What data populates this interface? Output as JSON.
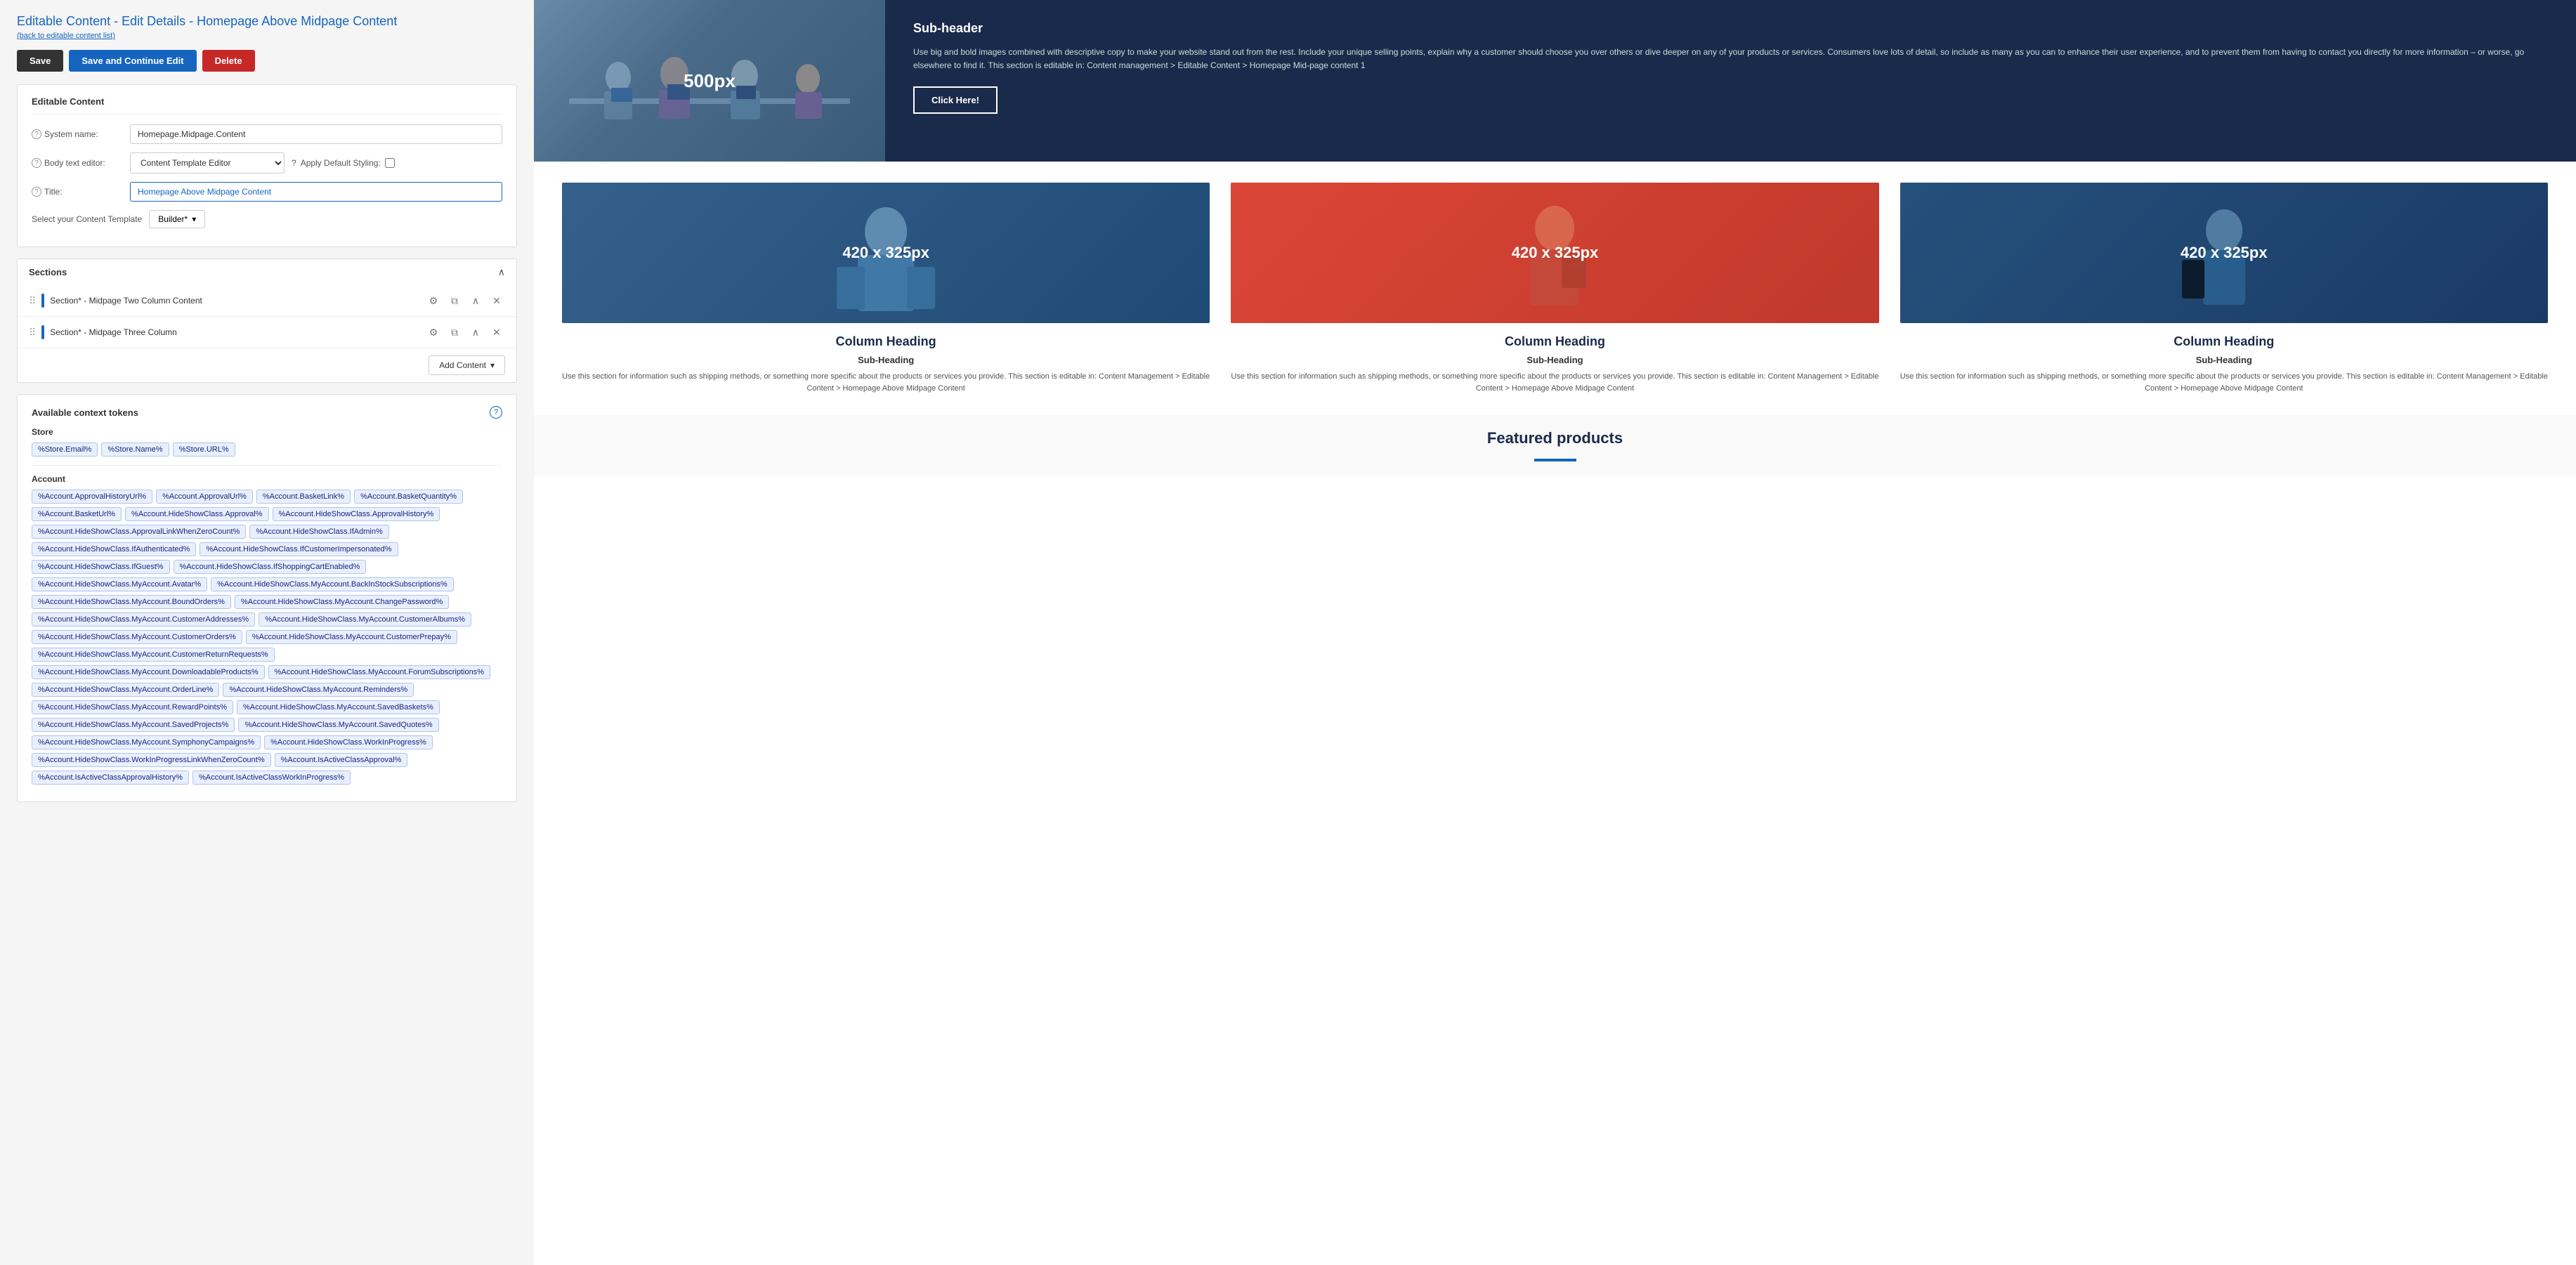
{
  "page": {
    "title_prefix": "Editable Content - Edit Details - ",
    "title_link": "Homepage Above Midpage Content",
    "back_link": "(back to editable content list)"
  },
  "toolbar": {
    "save_label": "Save",
    "save_continue_label": "Save and Continue Edit",
    "delete_label": "Delete"
  },
  "form": {
    "card_title": "Editable Content",
    "system_name_label": "System name:",
    "system_name_value": "Homepage.Midpage.Content",
    "body_editor_label": "Body text editor:",
    "body_editor_value": "Content Template Editor",
    "apply_styling_label": "Apply Default Styling:",
    "title_label": "Title:",
    "title_value": "Homepage Above Midpage Content",
    "template_label": "Select your Content Template",
    "template_value": "Builder*"
  },
  "sections": {
    "title": "Sections",
    "items": [
      {
        "name": "Section* - Midpage Two Column Content"
      },
      {
        "name": "Section* - Midpage Three Column"
      }
    ],
    "add_content_label": "Add Content"
  },
  "tokens": {
    "title": "Available context tokens",
    "store_group": "Store",
    "store_tokens": [
      "%Store.Email%",
      "%Store.Name%",
      "%Store.URL%"
    ],
    "account_group": "Account",
    "account_tokens": [
      "%Account.ApprovalHistoryUrl%",
      "%Account.ApprovalUrl%",
      "%Account.BasketLink%",
      "%Account.BasketQuantity%",
      "%Account.BasketUrl%",
      "%Account.HideShowClass.Approval%",
      "%Account.HideShowClass.ApprovalHistory%",
      "%Account.HideShowClass.ApprovalLinkWhenZeroCount%",
      "%Account.HideShowClass.IfAdmin%",
      "%Account.HideShowClass.IfAuthenticated%",
      "%Account.HideShowClass.IfCustomerImpersonated%",
      "%Account.HideShowClass.IfGuest%",
      "%Account.HideShowClass.IfShoppingCartEnabled%",
      "%Account.HideShowClass.MyAccount.Avatar%",
      "%Account.HideShowClass.MyAccount.BackInStockSubscriptions%",
      "%Account.HideShowClass.MyAccount.BoundOrders%",
      "%Account.HideShowClass.MyAccount.ChangePassword%",
      "%Account.HideShowClass.MyAccount.CustomerAddresses%",
      "%Account.HideShowClass.MyAccount.CustomerAlbums%",
      "%Account.HideShowClass.MyAccount.CustomerOrders%",
      "%Account.HideShowClass.MyAccount.CustomerPrepay%",
      "%Account.HideShowClass.MyAccount.CustomerReturnRequests%",
      "%Account.HideShowClass.MyAccount.DownloadableProducts%",
      "%Account.HideShowClass.MyAccount.ForumSubscriptions%",
      "%Account.HideShowClass.MyAccount.OrderLine%",
      "%Account.HideShowClass.MyAccount.Reminders%",
      "%Account.HideShowClass.MyAccount.RewardPoints%",
      "%Account.HideShowClass.MyAccount.SavedBaskets%",
      "%Account.HideShowClass.MyAccount.SavedProjects%",
      "%Account.HideShowClass.MyAccount.SavedQuotes%",
      "%Account.HideShowClass.MyAccount.SymphonyCampaigns%",
      "%Account.HideShowClass.WorkInProgress%",
      "%Account.HideShowClass.WorkInProgressLinkWhenZeroCount%",
      "%Account.IsActiveClassApproval%",
      "%Account.IsActiveClassApprovalHistory%",
      "%Account.IsActiveClassWorkInProgress%"
    ]
  },
  "preview": {
    "hero": {
      "img_label": "500px",
      "subheader": "Sub-header",
      "text": "Use big and bold images combined with descriptive copy to make your website stand out from the rest. Include your unique selling points, explain why a customer should choose you over others or dive deeper on any of your products or services. Consumers love lots of detail, so include as many as you can to enhance their user experience, and to prevent them from having to contact you directly for more information – or worse, go elsewhere to find it. This section is editable in: Content management > Editable Content > Homepage Mid-page content 1",
      "button_label": "Click Here!"
    },
    "columns": {
      "heading1": "Column Heading",
      "heading2": "Column Heading",
      "heading3": "Column Heading",
      "subheading1": "Sub-Heading",
      "subheading2": "Sub-Heading",
      "subheading3": "Sub-Heading",
      "img_label": "420 x 325px",
      "text": "Use this section for information such as shipping methods, or something more specific about the products or services you provide. This section is editable in: Content Management > Editable Content > Homepage Above Midpage Content"
    },
    "featured": {
      "title": "Featured products"
    }
  }
}
